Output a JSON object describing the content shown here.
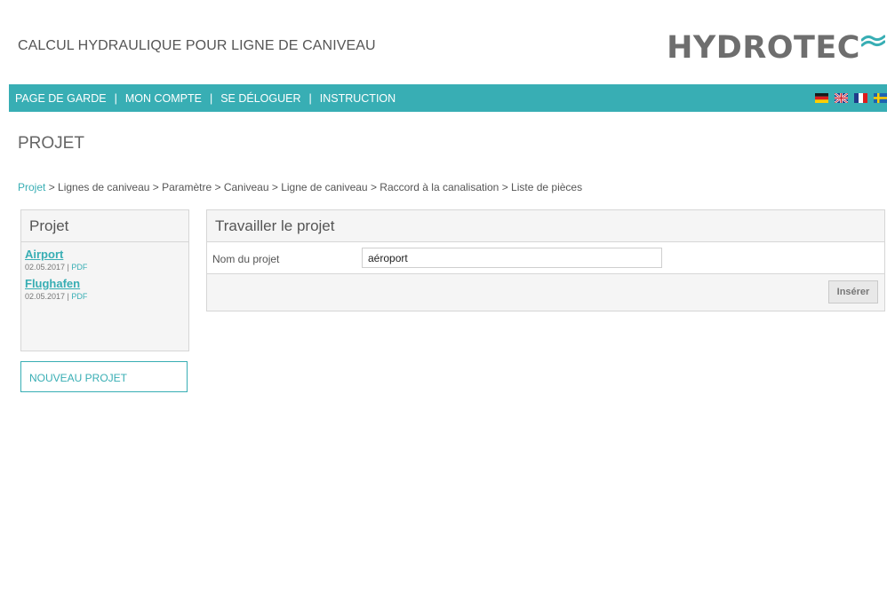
{
  "header": {
    "app_title": "CALCUL HYDRAULIQUE POUR LIGNE DE CANIVEAU",
    "logo_text": "HYDROTEC",
    "logo_color": "#6e6e6e",
    "logo_wave_color": "#38aeb4"
  },
  "nav": {
    "background": "#38aeb4",
    "items": [
      {
        "label": "PAGE DE GARDE"
      },
      {
        "label": "MON COMPTE"
      },
      {
        "label": "SE DÉLOGUER"
      },
      {
        "label": "INSTRUCTION"
      }
    ],
    "separator": "|",
    "flags": [
      "german-flag-icon",
      "uk-flag-icon",
      "french-flag-icon",
      "swedish-flag-icon"
    ]
  },
  "page": {
    "heading": "PROJET"
  },
  "breadcrumb": {
    "first_link": "Projet",
    "rest": " > Lignes de caniveau > Paramètre > Caniveau > Ligne de caniveau > Raccord à la canalisation > Liste de pièces"
  },
  "sidebar": {
    "title": "Projet",
    "projects": [
      {
        "name": "Airport",
        "date": "02.05.2017",
        "sep": " | ",
        "pdf": "PDF"
      },
      {
        "name": "Flughafen",
        "date": "02.05.2017",
        "sep": " | ",
        "pdf": "PDF"
      }
    ],
    "new_project_label": "NOUVEAU PROJET"
  },
  "panel": {
    "title": "Travailler le projet",
    "field_label": "Nom du projet",
    "field_value": "aéroport",
    "insert_label": "Insérer"
  }
}
